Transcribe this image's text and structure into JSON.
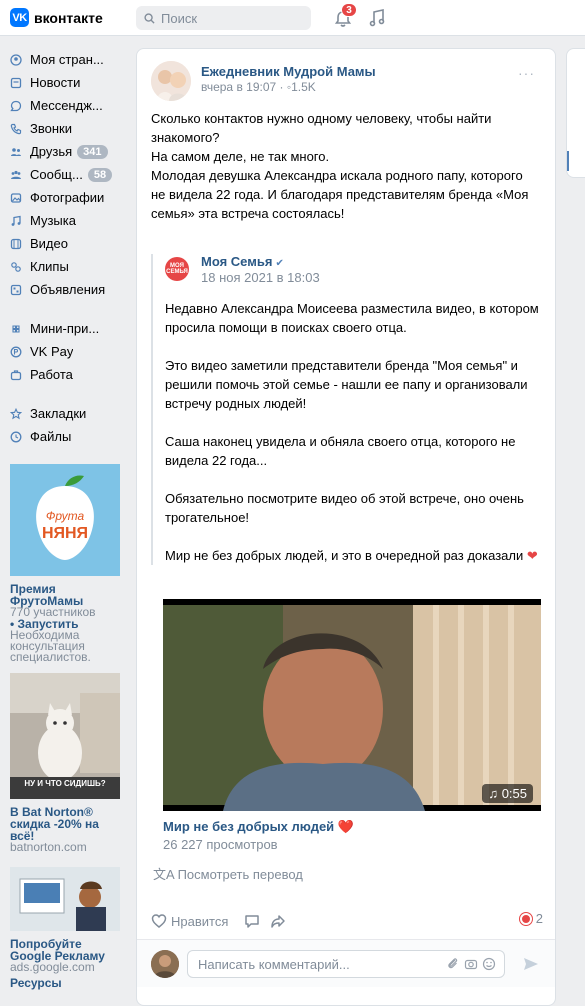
{
  "header": {
    "logo_text": "вконтакте",
    "logo_mark": "VK",
    "search_placeholder": "Поиск",
    "notifications_count": "3"
  },
  "sidebar": {
    "items": [
      {
        "label": "Моя стран...",
        "icon": "user-circle-icon"
      },
      {
        "label": "Новости",
        "icon": "newspaper-icon"
      },
      {
        "label": "Мессендж...",
        "icon": "message-icon"
      },
      {
        "label": "Звонки",
        "icon": "phone-icon"
      },
      {
        "label": "Друзья",
        "icon": "friends-icon",
        "badge": "341"
      },
      {
        "label": "Сообщ...",
        "icon": "communities-icon",
        "badge": "58"
      },
      {
        "label": "Фотографии",
        "icon": "photo-icon"
      },
      {
        "label": "Музыка",
        "icon": "music-icon"
      },
      {
        "label": "Видео",
        "icon": "video-icon"
      },
      {
        "label": "Клипы",
        "icon": "clips-icon"
      },
      {
        "label": "Объявления",
        "icon": "classifieds-icon"
      },
      {
        "label": "Мини-при...",
        "icon": "mini-apps-icon"
      },
      {
        "label": "VK Pay",
        "icon": "vkpay-icon"
      },
      {
        "label": "Работа",
        "icon": "work-icon"
      },
      {
        "label": "Закладки",
        "icon": "bookmark-icon"
      },
      {
        "label": "Файлы",
        "icon": "files-icon"
      }
    ]
  },
  "ads": [
    {
      "image_text_top": "Фрута",
      "image_text_bottom": "НЯНЯ",
      "title": "Премия ФрутоМамы",
      "sub1": "770 участников",
      "link": "• Запустить",
      "sub2": "Необходима консультация специалистов."
    },
    {
      "image_caption": "НУ И ЧТО СИДИШЬ?",
      "title": "В Bat Norton® скидка -20% на всё!",
      "sub1": "batnorton.com"
    },
    {
      "title": "Попробуйте Google Рекламу",
      "sub1": "ads.google.com",
      "title2": "Ресурсы"
    }
  ],
  "post": {
    "author": "Ежедневник Мудрой Мамы",
    "meta": "вчера в 19:07 · ◦1.5K",
    "more": "···",
    "text": "Сколько контактов нужно одному человеку, чтобы найти знакомого?\nНа самом деле, не так много.\nМолодая девушка Александра искала родного папу, которого не видела 22 года. И благодаря представителям бренда «Моя семья» эта встреча состоялась!",
    "repost": {
      "avatar_text": "МОЯ СЕМЬЯ",
      "author": "Моя Семья",
      "verified": "✔",
      "date": "18 ноя 2021 в 18:03",
      "text": "Недавно Александра Моисеева разместила видео, в котором просила помощи в поисках своего отца.\n\nЭто видео заметили представители бренда \"Моя семья\" и решили помочь этой семье - нашли ее папу и организовали встречу родных людей!\n\nСаша наконец увидела и обняла своего отца, которого не видела 22 года...\n\nОбязательно посмотрите видео об этой встрече, оно очень трогательное!\n\nМир не без добрых людей, и это в очередной раз доказали",
      "heart": "❤"
    },
    "video": {
      "duration": "♫ 0:55",
      "title": "Мир не без добрых людей ❤️",
      "views": "26 227 просмотров"
    },
    "translate": "文A Посмотреть перевод",
    "actions": {
      "like_label": "Нравится",
      "reactions_count": "2"
    },
    "comment": {
      "placeholder": "Написать комментарий..."
    }
  },
  "colors": {
    "accent": "#0077ff",
    "link": "#2a5885",
    "muted": "#818c99",
    "badge_red": "#e64646"
  }
}
